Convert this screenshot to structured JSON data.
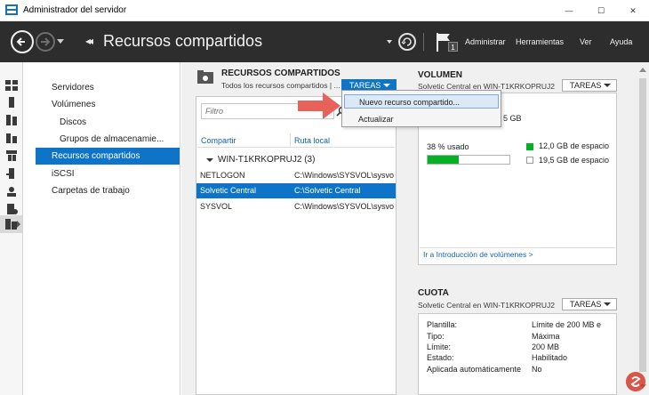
{
  "window": {
    "title": "Administrador del servidor",
    "minimize": "—",
    "maximize": "☐",
    "close": "✕"
  },
  "header": {
    "breadcrumb_marker": "◂◂",
    "title": "Recursos compartidos",
    "notification_count": "1",
    "menu": [
      "Administrar",
      "Herramientas",
      "Ver",
      "Ayuda"
    ]
  },
  "nav": {
    "items": [
      {
        "label": "Servidores",
        "sub": false,
        "active": false
      },
      {
        "label": "Volúmenes",
        "sub": false,
        "active": false
      },
      {
        "label": "Discos",
        "sub": true,
        "active": false
      },
      {
        "label": "Grupos de almacenamie...",
        "sub": true,
        "active": false
      },
      {
        "label": "Recursos compartidos",
        "sub": false,
        "active": true
      },
      {
        "label": "iSCSI",
        "sub": false,
        "active": false
      },
      {
        "label": "Carpetas de trabajo",
        "sub": false,
        "active": false
      }
    ],
    "rail_icons": [
      "dashboard-icon",
      "local-server-icon",
      "all-servers-icon",
      "file-services-icon",
      "hyperv-icon",
      "iis-icon",
      "remote-icon",
      "storage-services-icon"
    ]
  },
  "shares": {
    "title": "RECURSOS COMPARTIDOS",
    "subtitle": "Todos los recursos compartidos | ...",
    "tasks_label": "TAREAS",
    "filter_placeholder": "Filtro",
    "columns": [
      "Compartir",
      "Ruta local"
    ],
    "group": "WIN-T1KRKOPRUJ2 (3)",
    "rows": [
      {
        "share": "NETLOGON",
        "path": "C:\\Windows\\SYSVOL\\sysvol\\s",
        "selected": false
      },
      {
        "share": "Solvetic Central",
        "path": "C:\\Solvetic Central",
        "selected": true
      },
      {
        "share": "SYSVOL",
        "path": "C:\\Windows\\SYSVOL\\sysvol",
        "selected": false
      }
    ],
    "menu": [
      {
        "label": "Nuevo recurso compartido...",
        "highlighted": true
      },
      {
        "label": "Actualizar",
        "highlighted": false
      }
    ]
  },
  "volume": {
    "title": "VOLUMEN",
    "subtitle": "Solvetic Central en WIN-T1KRKOPRUJ2",
    "tasks_label": "TAREAS",
    "capacity_fragment": "5 GB",
    "used_label": "38 % usado",
    "used_fraction": 0.38,
    "legend": [
      {
        "label": "12,0 GB de espacio",
        "color": "#06b025"
      },
      {
        "label": "19,5 GB de espacio",
        "color": "#ffffff"
      }
    ],
    "link": "Ir a Introducción de volúmenes >"
  },
  "quota": {
    "title": "CUOTA",
    "subtitle": "Solvetic Central en WIN-T1KRKOPRUJ2",
    "tasks_label": "TAREAS",
    "rows": [
      {
        "key": "Plantilla:",
        "value": "Límite de 200 MB e"
      },
      {
        "key": "Tipo:",
        "value": "Máxima"
      },
      {
        "key": "Límite:",
        "value": "200 MB"
      },
      {
        "key": "Estado:",
        "value": "Habilitado"
      },
      {
        "key": "Aplicada automáticamente",
        "value": "No"
      }
    ]
  },
  "colors": {
    "accent": "#0e74c8",
    "header_bg": "#2d2d2d",
    "usage_green": "#06b025",
    "arrow_red": "#e8615a"
  }
}
